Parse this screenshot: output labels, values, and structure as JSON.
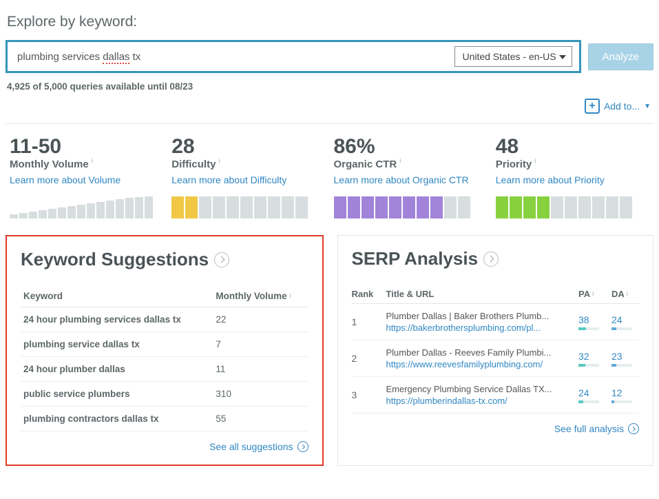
{
  "header": {
    "label": "Explore by keyword:"
  },
  "search": {
    "query_pre": "plumbing services ",
    "query_typo": "dallas",
    "query_post": " tx",
    "locale": "United States - en-US",
    "analyze": "Analyze"
  },
  "quota": "4,925 of 5,000 queries available until 08/23",
  "addto": "Add to...",
  "metrics": {
    "volume": {
      "value": "11-50",
      "label": "Monthly Volume",
      "link": "Learn more about Volume"
    },
    "difficulty": {
      "value": "28",
      "label": "Difficulty",
      "link": "Learn more about Difficulty",
      "filled": 2
    },
    "ctr": {
      "value": "86%",
      "label": "Organic CTR",
      "link": "Learn more about Organic CTR",
      "filled": 8
    },
    "priority": {
      "value": "48",
      "label": "Priority",
      "link": "Learn more about Priority",
      "filled": 4
    }
  },
  "suggestions": {
    "title": "Keyword Suggestions",
    "col_keyword": "Keyword",
    "col_volume": "Monthly Volume",
    "rows": [
      {
        "kw": "24 hour plumbing services dallas tx",
        "vol": "22"
      },
      {
        "kw": "plumbing service dallas tx",
        "vol": "7"
      },
      {
        "kw": "24 hour plumber dallas",
        "vol": "11"
      },
      {
        "kw": "public service plumbers",
        "vol": "310"
      },
      {
        "kw": "plumbing contractors dallas tx",
        "vol": "55"
      }
    ],
    "see_all": "See all suggestions"
  },
  "serp": {
    "title": "SERP Analysis",
    "col_rank": "Rank",
    "col_title": "Title & URL",
    "col_pa": "PA",
    "col_da": "DA",
    "rows": [
      {
        "rank": "1",
        "title": "Plumber Dallas | Baker Brothers Plumb...",
        "url": "https://bakerbrothersplumbing.com/pl...",
        "pa": "38",
        "pa_pct": 38,
        "da": "24",
        "da_pct": 24
      },
      {
        "rank": "2",
        "title": "Plumber Dallas - Reeves Family Plumbi...",
        "url": "https://www.reevesfamilyplumbing.com/",
        "pa": "32",
        "pa_pct": 32,
        "da": "23",
        "da_pct": 23
      },
      {
        "rank": "3",
        "title": "Emergency Plumbing Service Dallas TX...",
        "url": "https://plumberindallas-tx.com/",
        "pa": "24",
        "pa_pct": 24,
        "da": "12",
        "da_pct": 12
      }
    ],
    "see_all": "See full analysis"
  }
}
